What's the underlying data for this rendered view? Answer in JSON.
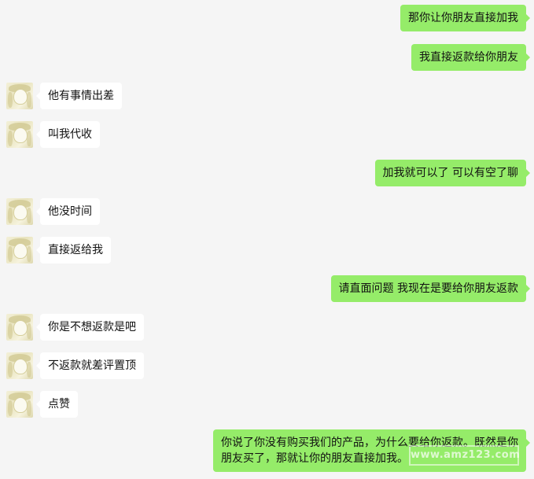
{
  "messages": [
    {
      "side": "right",
      "text": "那你让你朋友直接加我"
    },
    {
      "side": "right",
      "text": "我直接返款给你朋友"
    },
    {
      "side": "left",
      "text": "他有事情出差"
    },
    {
      "side": "left",
      "text": "叫我代收"
    },
    {
      "side": "right",
      "text": "加我就可以了 可以有空了聊"
    },
    {
      "side": "left",
      "text": "他没时间"
    },
    {
      "side": "left",
      "text": "直接返给我"
    },
    {
      "side": "right",
      "text": "请直面问题 我现在是要给你朋友返款"
    },
    {
      "side": "left",
      "text": "你是不想返款是吧"
    },
    {
      "side": "left",
      "text": "不返款就差评置顶"
    },
    {
      "side": "left",
      "text": "点赞"
    },
    {
      "side": "right",
      "text": "你说了你没有购买我们的产品，为什么要给你返款。既然是你朋友买了，那就让你的朋友直接加我。"
    }
  ],
  "watermark": "www.amz123.com",
  "colors": {
    "background": "#f5f5f5",
    "outgoing_bubble": "#95ec69",
    "incoming_bubble": "#ffffff"
  },
  "icons": {
    "contact_avatar": "anime-girl-avatar"
  }
}
